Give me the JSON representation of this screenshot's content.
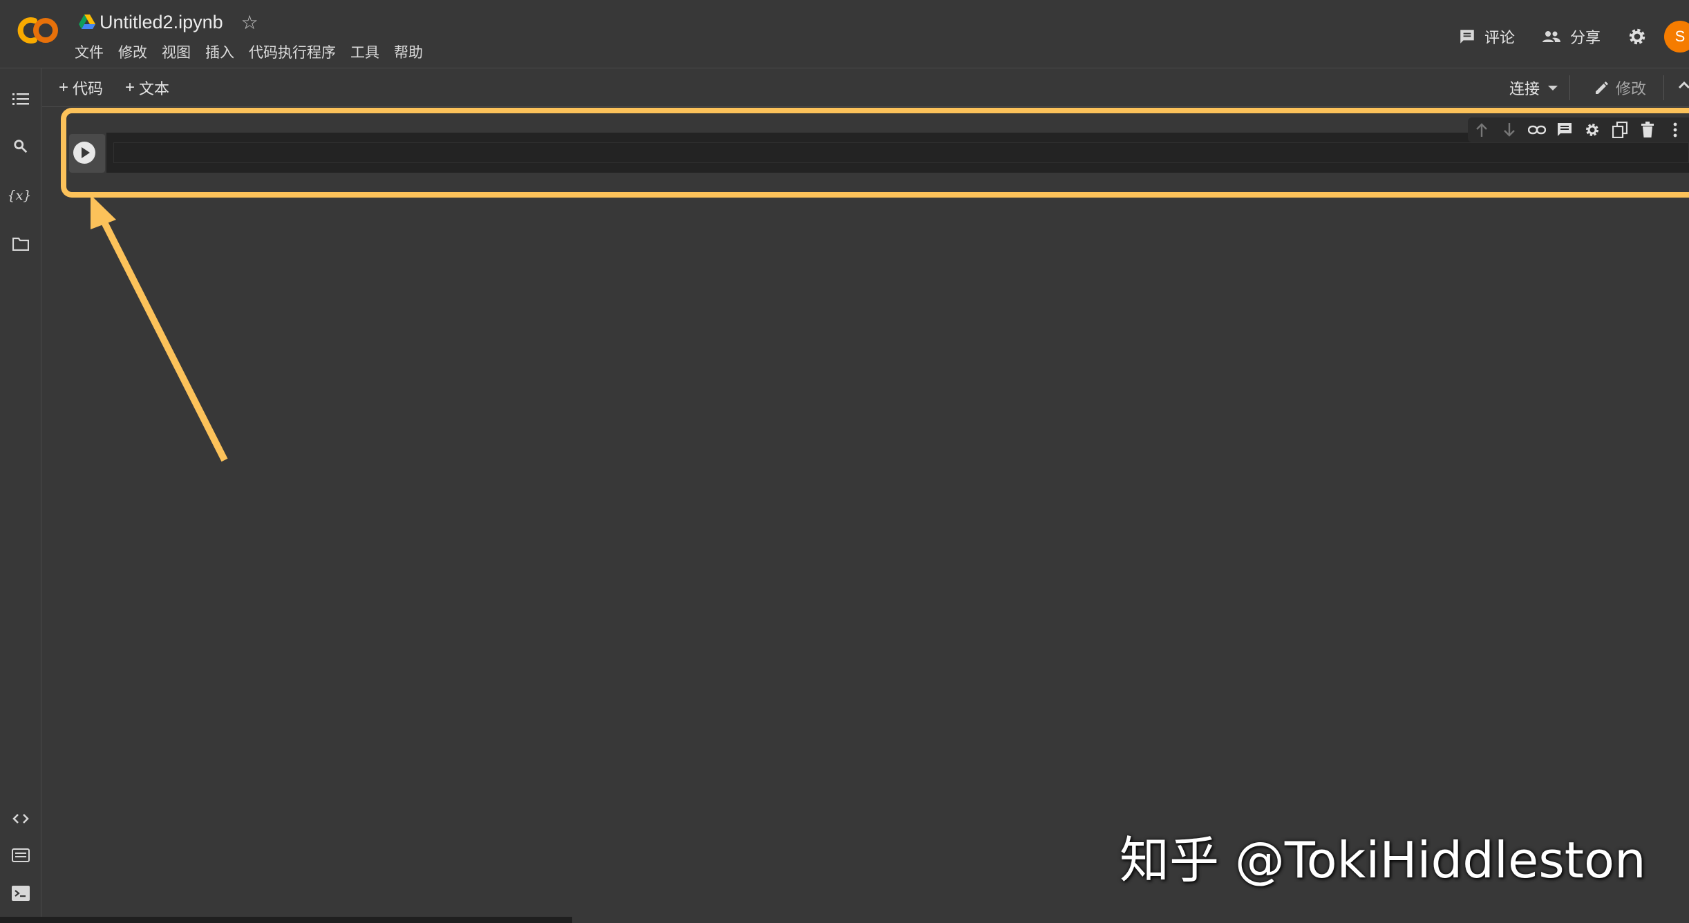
{
  "app": {
    "name": "Colaboratory"
  },
  "document": {
    "title": "Untitled2.ipynb"
  },
  "menu": [
    "文件",
    "修改",
    "视图",
    "插入",
    "代码执行程序",
    "工具",
    "帮助"
  ],
  "header_actions": {
    "comment_label": "评论",
    "share_label": "分享",
    "avatar_letter": "S"
  },
  "toolbar": {
    "add_code_label": "代码",
    "add_text_label": "文本",
    "connect_label": "连接",
    "edit_label": "修改"
  },
  "sidebar": {
    "icons": [
      "toc-icon",
      "search-icon",
      "variables-icon",
      "folder-icon",
      "code-snippets-icon",
      "command-palette-icon",
      "terminal-icon"
    ]
  },
  "cell_toolbar": {
    "icons": [
      "move-up-icon",
      "move-down-icon",
      "link-icon",
      "comment-icon",
      "settings-icon",
      "mirror-icon",
      "delete-icon",
      "more-icon"
    ]
  },
  "watermark": {
    "text": "知乎 @TokiHiddleston"
  },
  "colors": {
    "background": "#383838",
    "highlight": "#fcc25a",
    "avatar": "#f57c00",
    "editor": "#232323"
  }
}
